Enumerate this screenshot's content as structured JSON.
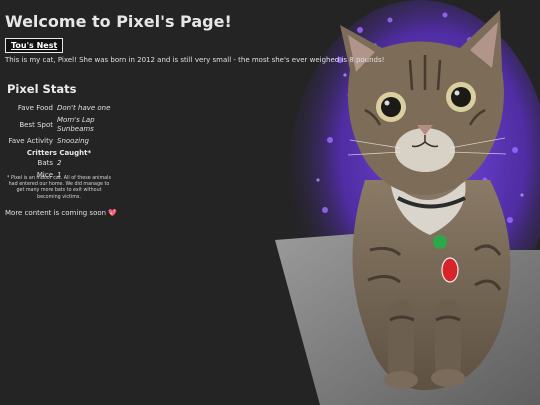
{
  "page": {
    "title": "Welcome to Pixel's Page!",
    "nest_button": "Tou's Nest",
    "intro": "This is my cat, Pixel! She was born in 2012 and is still very small - the most she's ever weighed is 8 pounds!"
  },
  "stats": {
    "heading": "Pixel Stats",
    "rows": [
      {
        "label": "Fave Food",
        "value": "Don't have one"
      },
      {
        "label": "Best Spot",
        "value": "Mom's Lap Sunbeams"
      },
      {
        "label": "Fave Activity",
        "value": "Snoozing"
      }
    ],
    "critters_heading": "Critters Caught*",
    "critters": [
      {
        "label": "Bats",
        "value": "2"
      },
      {
        "label": "Mice",
        "value": "1"
      }
    ],
    "footnote": "* Pixel is an indoor cat. All of these animals had entered our home. We did manage to get many more bats to exit without becoming victims."
  },
  "footer": {
    "more_text": "More content is coming soon",
    "heart": "💖"
  },
  "colors": {
    "background": "#242424",
    "text": "#e8e8e8",
    "flowers": "#6a3fd8"
  },
  "image": {
    "subject": "tabby cat sitting on grey carpeted cat tree in front of purple flowers"
  }
}
